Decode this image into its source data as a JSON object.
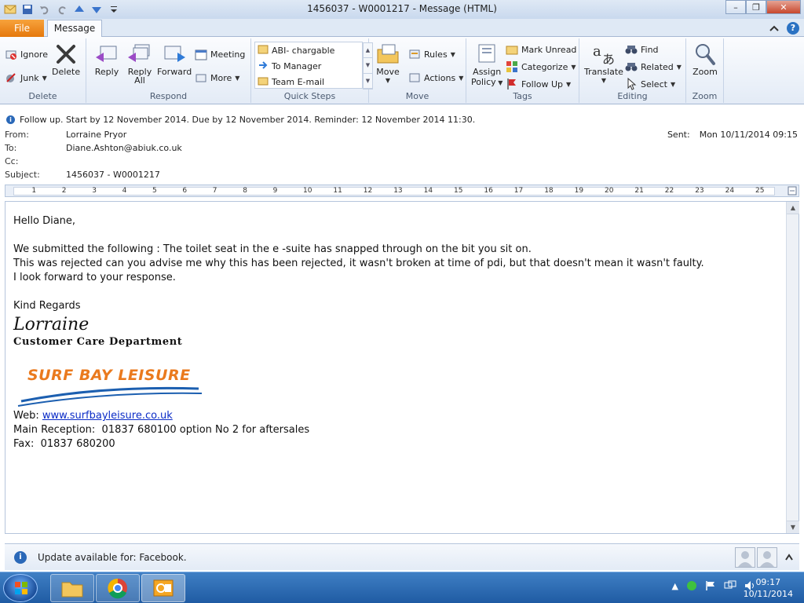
{
  "window": {
    "title": "1456037  - W0001217  - Message (HTML)",
    "minimize": "–",
    "maximize": "❐",
    "close": "✕"
  },
  "tabs": {
    "file": "File",
    "message": "Message"
  },
  "ribbon": {
    "delete_group": {
      "label": "Delete",
      "ignore": "Ignore",
      "junk": "Junk",
      "delete": "Delete"
    },
    "respond_group": {
      "label": "Respond",
      "reply": "Reply",
      "reply_all_1": "Reply",
      "reply_all_2": "All",
      "forward": "Forward",
      "meeting": "Meeting",
      "more": "More"
    },
    "quick_steps": {
      "label": "Quick Steps",
      "items": [
        "ABI- chargable",
        "To Manager",
        "Team E-mail"
      ]
    },
    "move_group": {
      "label": "Move",
      "move": "Move",
      "rules": "Rules",
      "actions": "Actions"
    },
    "tags_group": {
      "label": "Tags",
      "assign_policy_1": "Assign",
      "assign_policy_2": "Policy",
      "mark_unread": "Mark Unread",
      "categorize": "Categorize",
      "follow_up": "Follow Up"
    },
    "editing_group": {
      "label": "Editing",
      "translate": "Translate",
      "find": "Find",
      "related": "Related",
      "select": "Select"
    },
    "zoom_group": {
      "label": "Zoom",
      "zoom": "Zoom"
    }
  },
  "info": "Follow up.  Start by 12 November 2014.  Due by 12 November 2014.  Reminder: 12 November 2014 11:30.",
  "header": {
    "from_label": "From:",
    "from": "Lorraine Pryor",
    "to_label": "To:",
    "to": "Diane.Ashton@abiuk.co.uk",
    "cc_label": "Cc:",
    "subject_label": "Subject:",
    "subject": "1456037  - W0001217",
    "sent_label": "Sent:",
    "sent": "Mon 10/11/2014 09:15"
  },
  "ruler": {
    "ticks": [
      "1",
      "2",
      "3",
      "4",
      "5",
      "6",
      "7",
      "8",
      "9",
      "10",
      "11",
      "12",
      "13",
      "14",
      "15",
      "16",
      "17",
      "18",
      "19",
      "20",
      "21",
      "22",
      "23",
      "24",
      "25"
    ]
  },
  "body": {
    "greeting": "Hello Diane,",
    "line1": "We submitted the following : The toilet seat in the e -suite has snapped through on the bit you sit on.",
    "line2": "This was rejected can you advise me why this has been rejected, it wasn't broken at time of pdi, but that doesn't mean it wasn't faulty.",
    "line3": "I look forward to your response.",
    "closing": "Kind Regards",
    "signature_name": "Lorraine",
    "department": "Customer Care Department",
    "logo_text": "SURF BAY LEISURE",
    "web_label": "Web: ",
    "web_url": "www.surfbayleisure.co.uk",
    "reception": "Main Reception:  01837 680100 option No 2 for aftersales",
    "fax": "Fax:  01837 680200"
  },
  "status": {
    "text": "Update available for: Facebook."
  },
  "taskbar": {
    "time": "09:17",
    "date": "10/11/2014"
  },
  "colors": {
    "file_tab": "#e5780c",
    "link": "#0b2cc7",
    "logo_orange": "#ea7a1e",
    "logo_blue": "#1c5fb0"
  }
}
